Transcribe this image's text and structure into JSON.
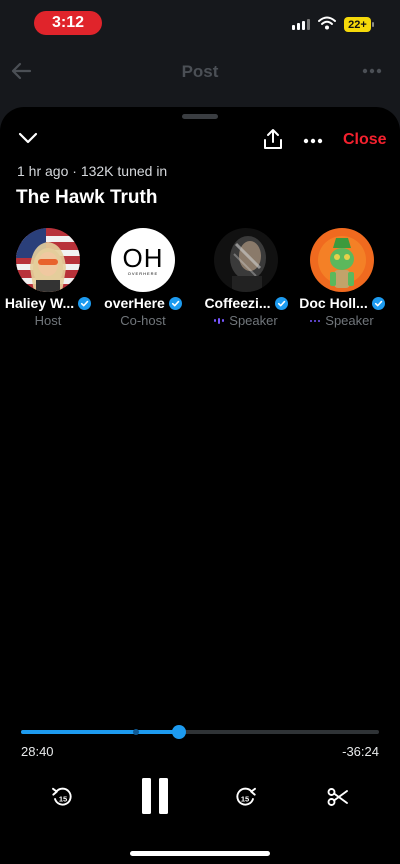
{
  "status_bar": {
    "time": "3:12",
    "battery": "22+"
  },
  "page": {
    "title": "Post"
  },
  "space": {
    "close_label": "Close",
    "meta": "1 hr ago · 132K tuned in",
    "title": "The Hawk Truth",
    "participants": [
      {
        "name": "Haliey W...",
        "role": "Host",
        "verified": true,
        "speaking": false
      },
      {
        "name": "overHere",
        "role": "Co-host",
        "verified": true,
        "speaking": false,
        "avatar_text": "OH",
        "avatar_subtext": "OVERHERE"
      },
      {
        "name": "Coffeezi...",
        "role": "Speaker",
        "verified": true,
        "speaking": true
      },
      {
        "name": "Doc Holl...",
        "role": "Speaker",
        "verified": true,
        "speaking": false
      }
    ]
  },
  "player": {
    "elapsed": "28:40",
    "remaining": "-36:24",
    "progress_fraction": 0.44,
    "buffer_mark_fraction": 0.32,
    "skip_back_seconds": "15",
    "skip_forward_seconds": "15"
  },
  "colors": {
    "accent": "#1d9bf0",
    "close": "#f4212e",
    "status_pill": "#e0242b",
    "battery": "#f5d90a"
  }
}
